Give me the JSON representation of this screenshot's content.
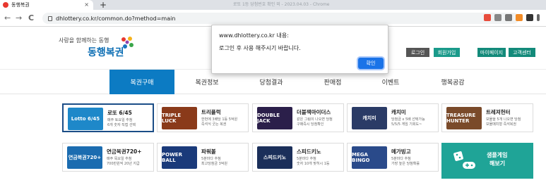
{
  "browser": {
    "tab_title": "동행복권",
    "tab_close": "×",
    "new_tab": "+",
    "window_title": "로또 1등 당첨번호 확인 외 - 2023.04.03 - Chrome",
    "url": "dhlottery.co.kr/common.do?method=main",
    "back": "←",
    "forward": "→",
    "reload": "C"
  },
  "header": {
    "slogan": "사랑을 함께하는 동행",
    "logo": "동행복권",
    "buttons": {
      "login": "로그인",
      "join": "회원가입",
      "mypage": "마이페이지",
      "support": "고객센터"
    }
  },
  "dialog": {
    "title": "www.dhlottery.co.kr 내용:",
    "message": "로그인 후 사용 해주시기 바랍니다.",
    "ok": "확인"
  },
  "nav": {
    "items": [
      "복권구매",
      "복권정보",
      "당첨결과",
      "판매점",
      "이벤트",
      "행복공감"
    ]
  },
  "games": [
    {
      "title": "로또 6/45",
      "desc1": "매주 토요일 추첨",
      "desc2": "6개 숫자 직접 선택",
      "img": "Lotto 6/45",
      "color": "#1e88c9"
    },
    {
      "title": "트리플럭",
      "desc1": "한번에 3배당 1등 5억원",
      "desc2": "즉석식 굿는 복권",
      "img": "TRIPLE LUCK",
      "color": "#8a3a1a"
    },
    {
      "title": "더블잭마이더스",
      "desc1": "같은 그림이 나오면 당첨",
      "desc2": "구매즉시 당첨확인",
      "img": "DOUBLE JACK",
      "color": "#2b1f4a"
    },
    {
      "title": "캐치미",
      "desc1": "당첨금 x 5배 선택가능",
      "desc2": "5/5/5 게임 기회도~",
      "img": "캐치미",
      "color": "#2a3b66"
    },
    {
      "title": "트레져헌터",
      "desc1": "보물을 5개 나오면 당첨",
      "desc2": "보물매치형 즉석복권",
      "img": "TREASURE HUNTER",
      "color": "#7a4a2a"
    },
    {
      "title": "연금복권720+",
      "desc1": "매주 목요일 추첨",
      "desc2": "700만원씩 20년 지급",
      "img": "연금복권720+",
      "color": "#1b6cb0"
    },
    {
      "title": "파워볼",
      "desc1": "5분마다 추첨",
      "desc2": "최고당첨금 3억원",
      "img": "POWER BALL",
      "color": "#1a3a7a"
    },
    {
      "title": "스피드키노",
      "desc1": "5분마다 추첨",
      "desc2": "숫자 10개 맞히시 1등",
      "img": "스피드키노",
      "color": "#1b2f5a"
    },
    {
      "title": "메가빙고",
      "desc1": "5분마다 추첨",
      "desc2": "가장 높은 당첨확률",
      "img": "MEGA BINGO",
      "color": "#2a4a8a"
    }
  ],
  "sample_game": {
    "line1": "샘플게임",
    "line2": "해보기"
  },
  "colors": {
    "nav_active": "#0c7bc3",
    "btn_dark": "#555555",
    "btn_teal": "#1a9a8a",
    "btn_green": "#138a7a",
    "dialog_ok": "#1a73e8",
    "sample_bg": "#1fa497"
  }
}
